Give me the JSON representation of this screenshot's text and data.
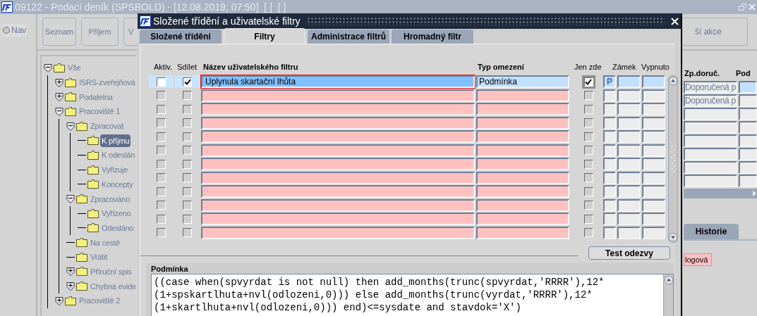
{
  "main_window": {
    "title": "09122 - Podací deník (SPSBOLD) - [12.08.2019; 07:50]  [ ]  [ ]"
  },
  "nav": {
    "label": "Nav",
    "selected": false
  },
  "toolbar": [
    "Seznam",
    "Příjem",
    "V"
  ],
  "toolbar_right": "ší akce",
  "tree": [
    {
      "label": "Vše",
      "expanded": true,
      "selected": false,
      "children": [
        {
          "label": "ISRS-zveřejňová",
          "expanded": false,
          "selected": false
        },
        {
          "label": "Podatelna",
          "expanded": false,
          "selected": false
        },
        {
          "label": "Pracoviště 1",
          "expanded": true,
          "selected": false,
          "children": [
            {
              "label": "Zpracovat",
              "expanded": true,
              "selected": false,
              "children": [
                {
                  "label": "K příjmu",
                  "selected": true
                },
                {
                  "label": "K odeslán",
                  "selected": false
                },
                {
                  "label": "Vyřizuje",
                  "selected": false
                },
                {
                  "label": "Koncepty",
                  "selected": false
                }
              ]
            },
            {
              "label": "Zpracováno",
              "expanded": true,
              "selected": false,
              "children": [
                {
                  "label": "Vyřízeno",
                  "selected": false
                },
                {
                  "label": "Odesláno",
                  "selected": false
                }
              ]
            },
            {
              "label": "Na cestě",
              "selected": false
            },
            {
              "label": "Vrátit",
              "selected": false
            },
            {
              "label": "Příruční spis",
              "expanded": false,
              "selected": false
            },
            {
              "label": "Chybná evide",
              "expanded": false,
              "selected": false
            }
          ]
        },
        {
          "label": "Pracoviště 2",
          "expanded": false,
          "selected": false
        }
      ]
    }
  ],
  "background_grid": {
    "columns": [
      "Zp.doruč.",
      "Pod"
    ],
    "rows": [
      {
        "column_1": "Doporučená p",
        "selected": true
      },
      {
        "column_1": "Doporučená p",
        "selected": false
      },
      {
        "selected": false
      },
      {
        "selected": false
      },
      {
        "selected": false
      },
      {
        "selected": false
      },
      {
        "selected": false
      },
      {
        "selected": false
      }
    ]
  },
  "background_tab": {
    "label": "Historie"
  },
  "background_field": {
    "value": "logová"
  },
  "dialog": {
    "title": "Složené třídění a uživatelské filtry",
    "tabs": [
      {
        "label": "Složené třídění",
        "selected": false
      },
      {
        "label": "Filtry",
        "selected": true
      },
      {
        "label": "Administrace filtrů",
        "selected": false
      },
      {
        "label": "Hromadný filtr",
        "selected": false
      }
    ],
    "columns": [
      "Aktiv.",
      "Sdílet",
      "Název uživatelského filtru",
      "Typ omezení",
      "Jen zde",
      "Zámek",
      "Vypnuto"
    ],
    "rows": [
      {
        "selected": true,
        "aktiv": false,
        "sdilet": true,
        "name": "Uplynula skartační lhůta",
        "type": "Podmínka",
        "jen_zde": true,
        "flag": "P"
      },
      {
        "selected": false,
        "aktiv": false,
        "sdilet": false,
        "jen_zde": false
      },
      {
        "selected": false,
        "aktiv": false,
        "sdilet": false,
        "jen_zde": false
      },
      {
        "selected": false,
        "aktiv": false,
        "sdilet": false,
        "jen_zde": false
      },
      {
        "selected": false,
        "aktiv": false,
        "sdilet": false,
        "jen_zde": false
      },
      {
        "selected": false,
        "aktiv": false,
        "sdilet": false,
        "jen_zde": false
      },
      {
        "selected": false,
        "aktiv": false,
        "sdilet": false,
        "jen_zde": false
      },
      {
        "selected": false,
        "aktiv": false,
        "sdilet": false,
        "jen_zde": false
      },
      {
        "selected": false,
        "aktiv": false,
        "sdilet": false,
        "jen_zde": false
      },
      {
        "selected": false,
        "aktiv": false,
        "sdilet": false,
        "jen_zde": false
      },
      {
        "selected": false,
        "aktiv": false,
        "sdilet": false,
        "jen_zde": false
      },
      {
        "selected": false,
        "aktiv": false,
        "sdilet": false,
        "jen_zde": false
      }
    ],
    "test_button": "Test odezvy",
    "condition": {
      "label": "Podmínka",
      "lines": [
        "((case when(spvyrdat is not null) then add_months(trunc(spvyrdat,'RRRR'),12*",
        "(1+spskartlhuta+nvl(odlozeni,0))) else add_months(trunc(vyrdat,'RRRR'),12*",
        "(1+skartlhuta+nvl(odlozeni,0))) end)<=sysdate and stavdok='X')"
      ]
    }
  }
}
